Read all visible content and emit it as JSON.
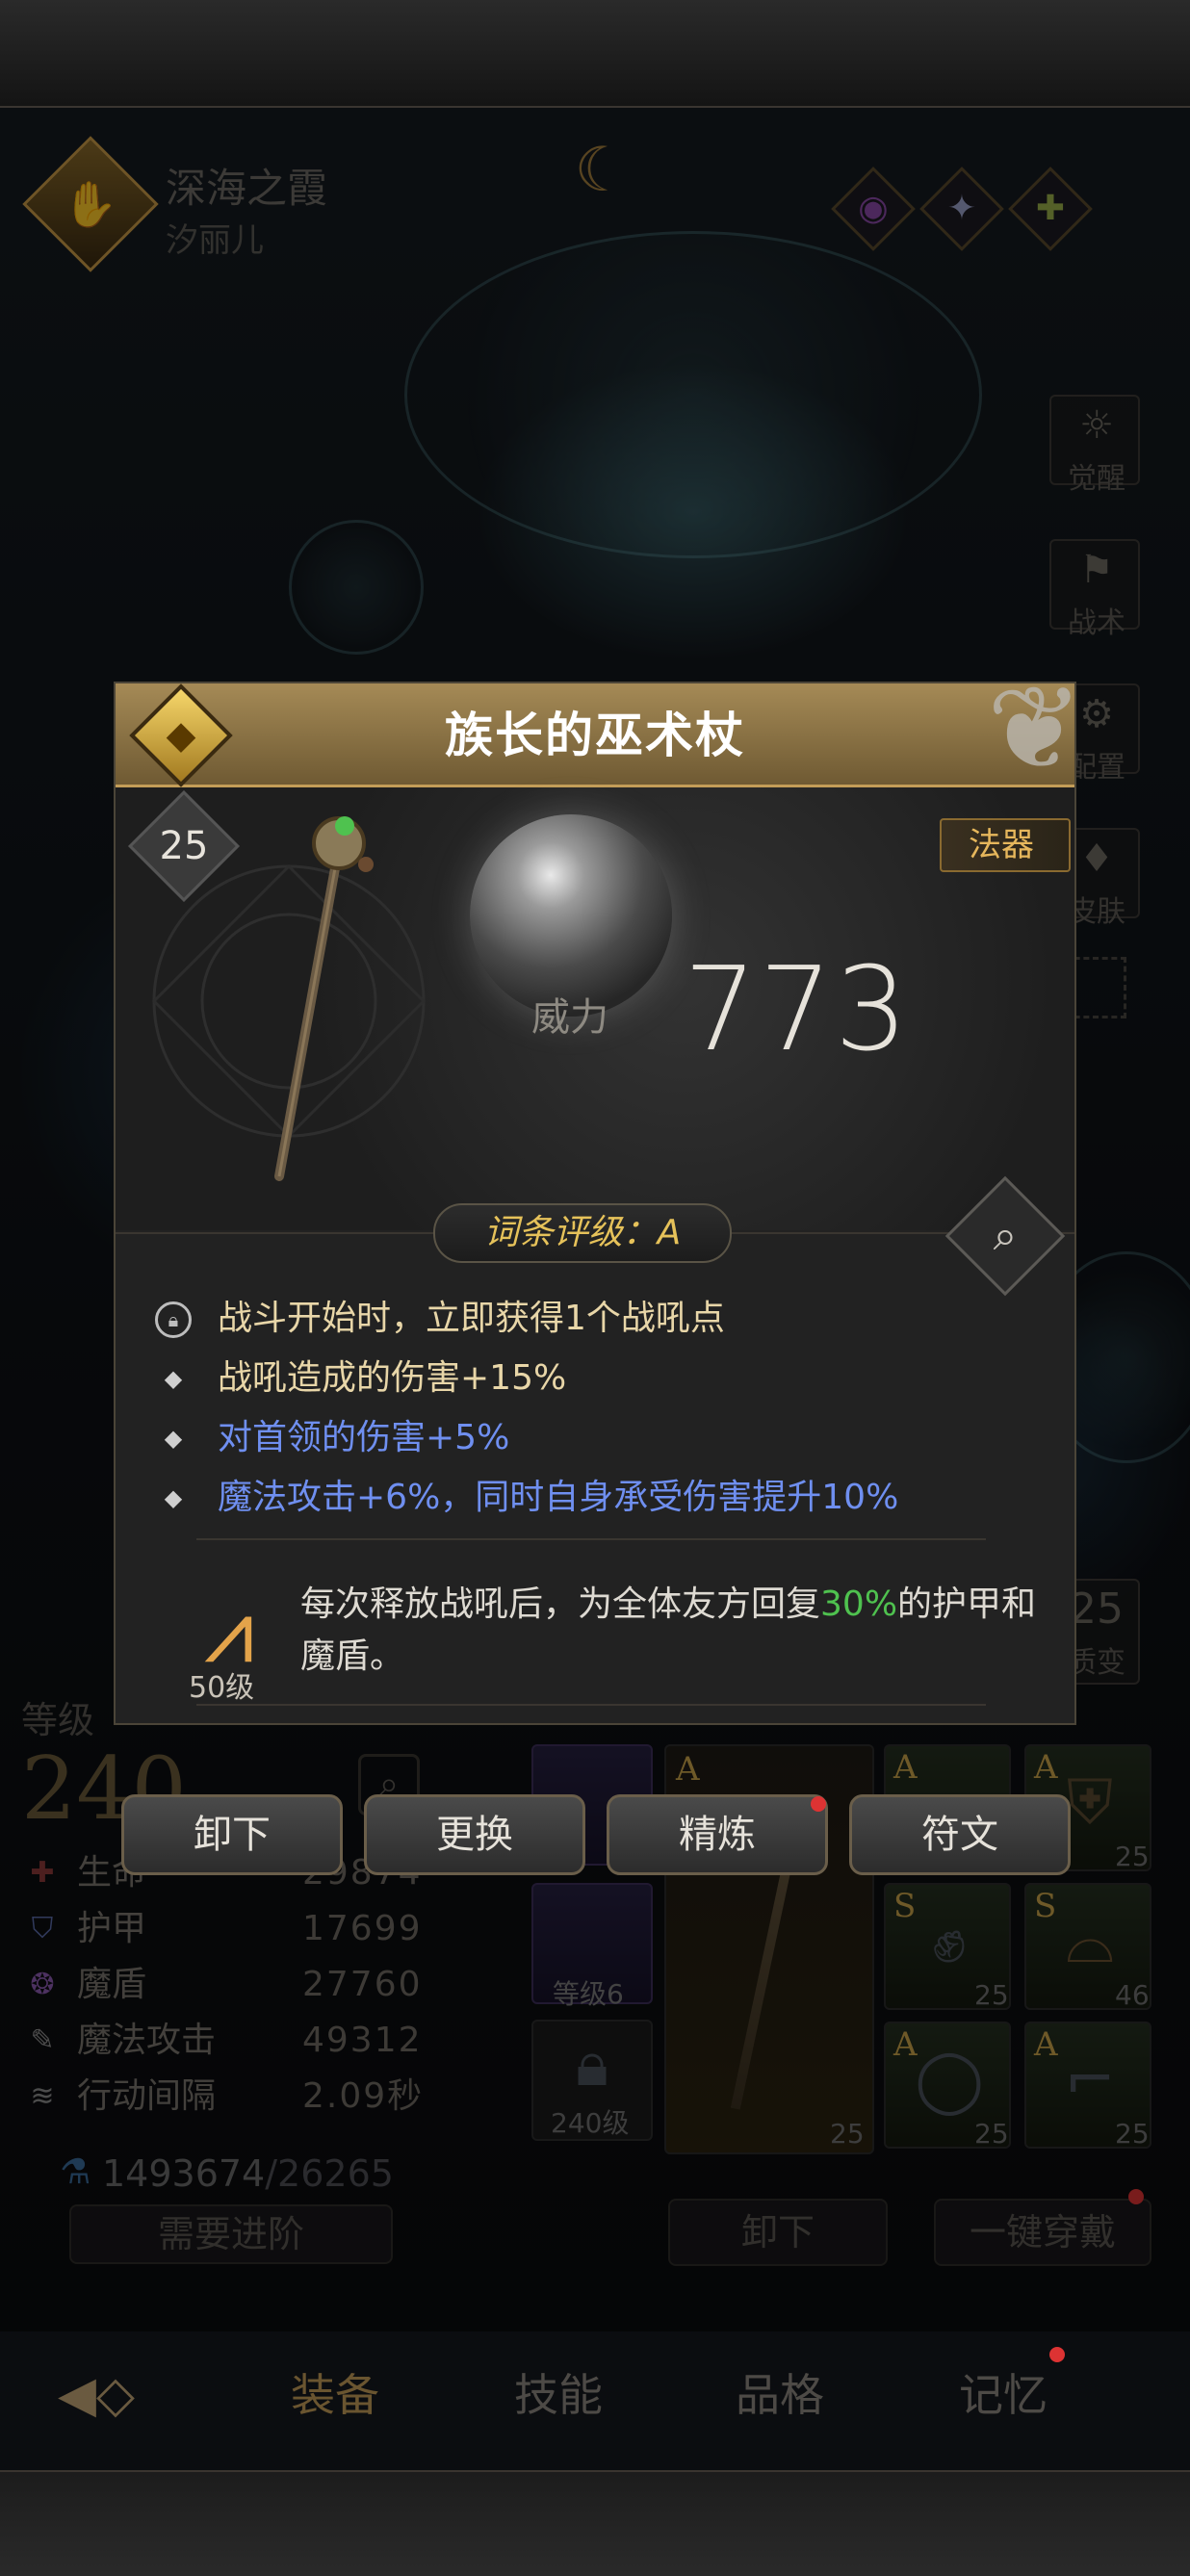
{
  "hero": {
    "name": "深海之霞",
    "subname": "汐丽儿"
  },
  "side_menu": [
    {
      "label": "觉醒",
      "icon": "sun-icon"
    },
    {
      "label": "战术",
      "icon": "banner-icon"
    },
    {
      "label": "配置",
      "icon": "cog-icon"
    },
    {
      "label": "皮肤",
      "icon": "shirt-icon"
    }
  ],
  "side_evolve": {
    "value": "25",
    "label": "质变"
  },
  "stats": {
    "level_label": "等级",
    "level": "240",
    "rows": [
      {
        "name": "生命",
        "value": "29874"
      },
      {
        "name": "护甲",
        "value": "17699"
      },
      {
        "name": "魔盾",
        "value": "27760"
      },
      {
        "name": "魔法攻击",
        "value": "49312"
      },
      {
        "name": "行动间隔",
        "value": "2.09秒"
      }
    ],
    "exp_current": "1493674",
    "exp_cap": "/26265",
    "advance_button": "需要进阶"
  },
  "slots": {
    "cheng_level": "等级6",
    "lock_level": "240级",
    "weapon_tag": "A",
    "weapon_num": "25",
    "items": [
      {
        "tag": "A",
        "num": "25"
      },
      {
        "tag": "A",
        "num": "25"
      },
      {
        "tag": "S",
        "num": "25"
      },
      {
        "tag": "S",
        "num": "46"
      },
      {
        "tag": "A",
        "num": "25"
      },
      {
        "tag": "A",
        "num": "25"
      }
    ],
    "unequip_button": "卸下",
    "one_click_button": "一键穿戴"
  },
  "nav": {
    "tabs": [
      "装备",
      "技能",
      "品格",
      "记忆"
    ]
  },
  "item": {
    "name": "族长的巫术杖",
    "level": "25",
    "type": "法器",
    "power_label": "威力",
    "power": "773",
    "rating_label": "词条评级：A",
    "affixes": [
      {
        "text": "战斗开始时，立即获得1个战吼点",
        "color": "#e8d6a8"
      },
      {
        "text": "战吼造成的伤害+15%",
        "color": "#e8d6a8"
      },
      {
        "text": "对首领的伤害+5%",
        "color": "#6f8ff0"
      },
      {
        "text": "魔法攻击+6%，同时自身承受伤害提升10%",
        "color": "#6f8ff0"
      }
    ],
    "set_level": "50级",
    "set_text_1": "每次释放战吼后，为全体友方回复",
    "set_text_pct": "30%",
    "set_text_2": "的护甲和魔盾。",
    "buttons": [
      "卸下",
      "更换",
      "精炼",
      "符文"
    ]
  },
  "colors": {
    "accent_gold": "#c39d58",
    "green": "#4fc24f",
    "blue_affix": "#6f8ff0"
  }
}
